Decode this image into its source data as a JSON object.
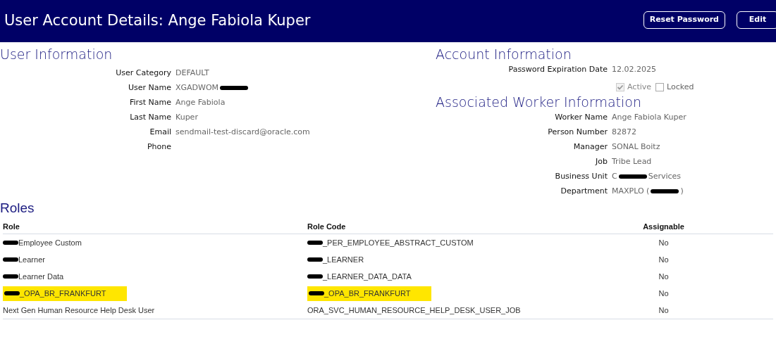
{
  "header": {
    "title": "User Account Details: Ange Fabiola Kuper",
    "buttons": [
      "Reset Password",
      "Edit"
    ]
  },
  "user_information": {
    "title": "User Information",
    "fields": [
      {
        "label": "User Category",
        "parts": [
          {
            "kind": "text",
            "text": "DEFAULT"
          }
        ]
      },
      {
        "label": "User Name",
        "parts": [
          {
            "kind": "text",
            "text": "XGADWOM"
          },
          {
            "kind": "redaction"
          }
        ]
      },
      {
        "label": "First Name",
        "parts": [
          {
            "kind": "text",
            "text": "Ange Fabiola"
          }
        ]
      },
      {
        "label": "Last Name",
        "parts": [
          {
            "kind": "text",
            "text": "Kuper"
          }
        ]
      },
      {
        "label": "Email",
        "parts": [
          {
            "kind": "text",
            "text": "sendmail-test-discard@oracle.com"
          }
        ]
      },
      {
        "label": "Phone"
      }
    ]
  },
  "account_information": {
    "title": "Account Information",
    "fields": [
      {
        "label": "Password Expiration Date",
        "parts": [
          {
            "kind": "text",
            "text": "12.02.2025"
          }
        ]
      }
    ],
    "checkboxes": [
      {
        "label": "Active",
        "checked": true,
        "disabled": true
      },
      {
        "label": "Locked",
        "checked": false,
        "disabled": false
      }
    ]
  },
  "worker_information": {
    "title": "Associated Worker Information",
    "fields": [
      {
        "label": "Worker Name",
        "parts": [
          {
            "kind": "text",
            "text": "Ange Fabiola Kuper"
          }
        ]
      },
      {
        "label": "Person Number",
        "parts": [
          {
            "kind": "text",
            "text": "82872"
          }
        ]
      },
      {
        "label": "Manager",
        "parts": [
          {
            "kind": "text",
            "text": "SONAL Boitz"
          }
        ]
      },
      {
        "label": "Job",
        "parts": [
          {
            "kind": "text",
            "text": "Tribe Lead"
          }
        ]
      },
      {
        "label": "Business Unit",
        "parts": [
          {
            "kind": "text",
            "text": "C"
          },
          {
            "kind": "redaction"
          },
          {
            "kind": "text",
            "text": "Services"
          }
        ]
      },
      {
        "label": "Department",
        "parts": [
          {
            "kind": "text",
            "text": "MAXPLO ("
          },
          {
            "kind": "redaction"
          },
          {
            "kind": "text",
            "text": ")"
          }
        ]
      }
    ]
  },
  "roles": {
    "title": "Roles",
    "columns": [
      "Role",
      "Role Code",
      "Assignable"
    ],
    "rows": [
      {
        "role": "Employee Custom",
        "role_redacted": true,
        "code": "_PER_EMPLOYEE_ABSTRACT_CUSTOM",
        "code_redacted": true,
        "assignable": "No",
        "highlighted": false
      },
      {
        "role": "Learner",
        "role_redacted": true,
        "code": "_LEARNER",
        "code_redacted": true,
        "assignable": "No",
        "highlighted": false
      },
      {
        "role": "Learner Data",
        "role_redacted": true,
        "code": "_LEARNER_DATA_DATA",
        "code_redacted": true,
        "assignable": "No",
        "highlighted": false
      },
      {
        "role": "_OPA_BR_FRANKFURT",
        "role_redacted": true,
        "code": "_OPA_BR_FRANKFURT",
        "code_redacted": true,
        "assignable": "No",
        "highlighted": true
      },
      {
        "role": "Next Gen Human Resource Help Desk User",
        "role_redacted": false,
        "code": "ORA_SVC_HUMAN_RESOURCE_HELP_DESK_USER_JOB",
        "code_redacted": false,
        "assignable": "No",
        "highlighted": false
      }
    ]
  }
}
